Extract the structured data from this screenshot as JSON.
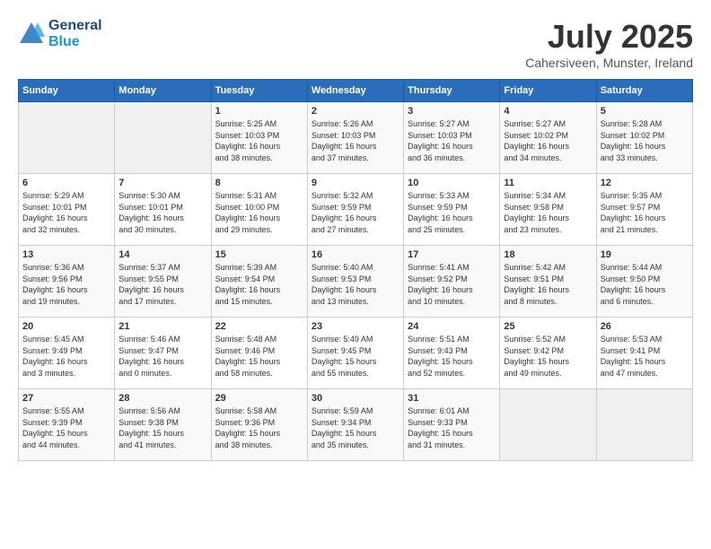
{
  "logo": {
    "line1": "General",
    "line2": "Blue"
  },
  "title": "July 2025",
  "subtitle": "Cahersiveen, Munster, Ireland",
  "weekdays": [
    "Sunday",
    "Monday",
    "Tuesday",
    "Wednesday",
    "Thursday",
    "Friday",
    "Saturday"
  ],
  "weeks": [
    [
      {
        "day": "",
        "info": ""
      },
      {
        "day": "",
        "info": ""
      },
      {
        "day": "1",
        "info": "Sunrise: 5:25 AM\nSunset: 10:03 PM\nDaylight: 16 hours\nand 38 minutes."
      },
      {
        "day": "2",
        "info": "Sunrise: 5:26 AM\nSunset: 10:03 PM\nDaylight: 16 hours\nand 37 minutes."
      },
      {
        "day": "3",
        "info": "Sunrise: 5:27 AM\nSunset: 10:03 PM\nDaylight: 16 hours\nand 36 minutes."
      },
      {
        "day": "4",
        "info": "Sunrise: 5:27 AM\nSunset: 10:02 PM\nDaylight: 16 hours\nand 34 minutes."
      },
      {
        "day": "5",
        "info": "Sunrise: 5:28 AM\nSunset: 10:02 PM\nDaylight: 16 hours\nand 33 minutes."
      }
    ],
    [
      {
        "day": "6",
        "info": "Sunrise: 5:29 AM\nSunset: 10:01 PM\nDaylight: 16 hours\nand 32 minutes."
      },
      {
        "day": "7",
        "info": "Sunrise: 5:30 AM\nSunset: 10:01 PM\nDaylight: 16 hours\nand 30 minutes."
      },
      {
        "day": "8",
        "info": "Sunrise: 5:31 AM\nSunset: 10:00 PM\nDaylight: 16 hours\nand 29 minutes."
      },
      {
        "day": "9",
        "info": "Sunrise: 5:32 AM\nSunset: 9:59 PM\nDaylight: 16 hours\nand 27 minutes."
      },
      {
        "day": "10",
        "info": "Sunrise: 5:33 AM\nSunset: 9:59 PM\nDaylight: 16 hours\nand 25 minutes."
      },
      {
        "day": "11",
        "info": "Sunrise: 5:34 AM\nSunset: 9:58 PM\nDaylight: 16 hours\nand 23 minutes."
      },
      {
        "day": "12",
        "info": "Sunrise: 5:35 AM\nSunset: 9:57 PM\nDaylight: 16 hours\nand 21 minutes."
      }
    ],
    [
      {
        "day": "13",
        "info": "Sunrise: 5:36 AM\nSunset: 9:56 PM\nDaylight: 16 hours\nand 19 minutes."
      },
      {
        "day": "14",
        "info": "Sunrise: 5:37 AM\nSunset: 9:55 PM\nDaylight: 16 hours\nand 17 minutes."
      },
      {
        "day": "15",
        "info": "Sunrise: 5:39 AM\nSunset: 9:54 PM\nDaylight: 16 hours\nand 15 minutes."
      },
      {
        "day": "16",
        "info": "Sunrise: 5:40 AM\nSunset: 9:53 PM\nDaylight: 16 hours\nand 13 minutes."
      },
      {
        "day": "17",
        "info": "Sunrise: 5:41 AM\nSunset: 9:52 PM\nDaylight: 16 hours\nand 10 minutes."
      },
      {
        "day": "18",
        "info": "Sunrise: 5:42 AM\nSunset: 9:51 PM\nDaylight: 16 hours\nand 8 minutes."
      },
      {
        "day": "19",
        "info": "Sunrise: 5:44 AM\nSunset: 9:50 PM\nDaylight: 16 hours\nand 6 minutes."
      }
    ],
    [
      {
        "day": "20",
        "info": "Sunrise: 5:45 AM\nSunset: 9:49 PM\nDaylight: 16 hours\nand 3 minutes."
      },
      {
        "day": "21",
        "info": "Sunrise: 5:46 AM\nSunset: 9:47 PM\nDaylight: 16 hours\nand 0 minutes."
      },
      {
        "day": "22",
        "info": "Sunrise: 5:48 AM\nSunset: 9:46 PM\nDaylight: 15 hours\nand 58 minutes."
      },
      {
        "day": "23",
        "info": "Sunrise: 5:49 AM\nSunset: 9:45 PM\nDaylight: 15 hours\nand 55 minutes."
      },
      {
        "day": "24",
        "info": "Sunrise: 5:51 AM\nSunset: 9:43 PM\nDaylight: 15 hours\nand 52 minutes."
      },
      {
        "day": "25",
        "info": "Sunrise: 5:52 AM\nSunset: 9:42 PM\nDaylight: 15 hours\nand 49 minutes."
      },
      {
        "day": "26",
        "info": "Sunrise: 5:53 AM\nSunset: 9:41 PM\nDaylight: 15 hours\nand 47 minutes."
      }
    ],
    [
      {
        "day": "27",
        "info": "Sunrise: 5:55 AM\nSunset: 9:39 PM\nDaylight: 15 hours\nand 44 minutes."
      },
      {
        "day": "28",
        "info": "Sunrise: 5:56 AM\nSunset: 9:38 PM\nDaylight: 15 hours\nand 41 minutes."
      },
      {
        "day": "29",
        "info": "Sunrise: 5:58 AM\nSunset: 9:36 PM\nDaylight: 15 hours\nand 38 minutes."
      },
      {
        "day": "30",
        "info": "Sunrise: 5:59 AM\nSunset: 9:34 PM\nDaylight: 15 hours\nand 35 minutes."
      },
      {
        "day": "31",
        "info": "Sunrise: 6:01 AM\nSunset: 9:33 PM\nDaylight: 15 hours\nand 31 minutes."
      },
      {
        "day": "",
        "info": ""
      },
      {
        "day": "",
        "info": ""
      }
    ]
  ]
}
